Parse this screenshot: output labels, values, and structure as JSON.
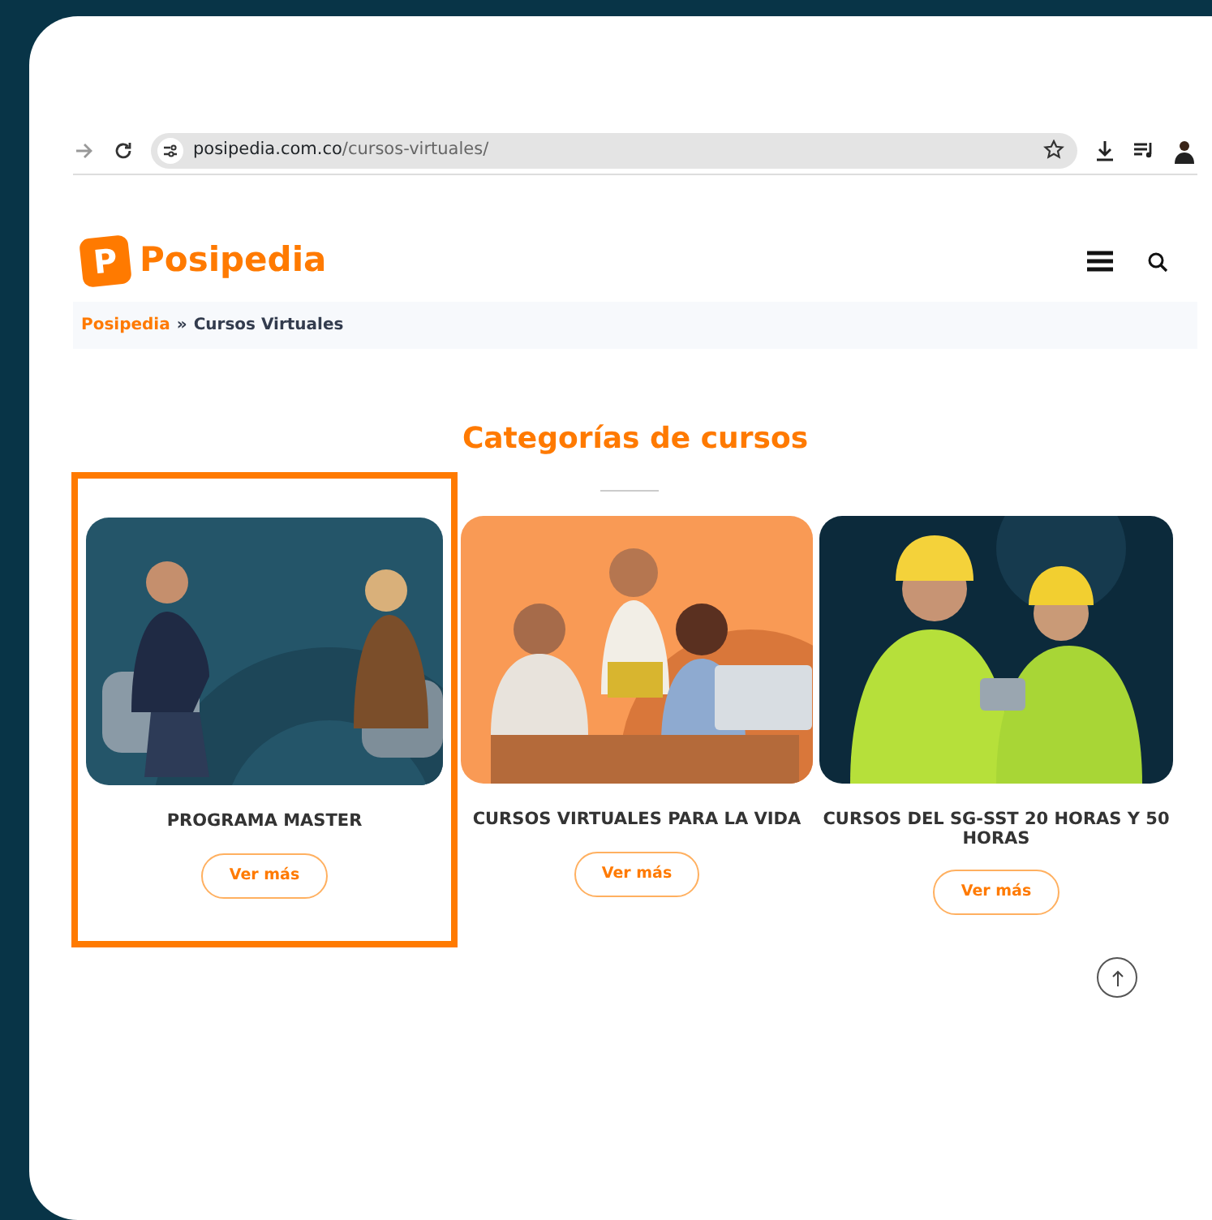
{
  "browser": {
    "url_host": "posipedia.com.co",
    "url_path": "/cursos-virtuales/"
  },
  "site": {
    "logo_letter": "P",
    "logo_text": "Posipedia"
  },
  "breadcrumb": [
    {
      "label": "Posipedia",
      "kind": "link"
    },
    {
      "label": "»",
      "kind": "separator"
    },
    {
      "label": "Cursos Virtuales",
      "kind": "current"
    }
  ],
  "section_title": "Categorías de cursos",
  "categories": [
    {
      "title": "PROGRAMA MASTER",
      "button": "Ver más",
      "selected": true
    },
    {
      "title": "CURSOS VIRTUALES PARA LA VIDA",
      "button": "Ver más",
      "selected": false
    },
    {
      "title": "CURSOS DEL SG-SST 20 HORAS Y 50 HORAS",
      "button": "Ver más",
      "selected": false
    }
  ]
}
